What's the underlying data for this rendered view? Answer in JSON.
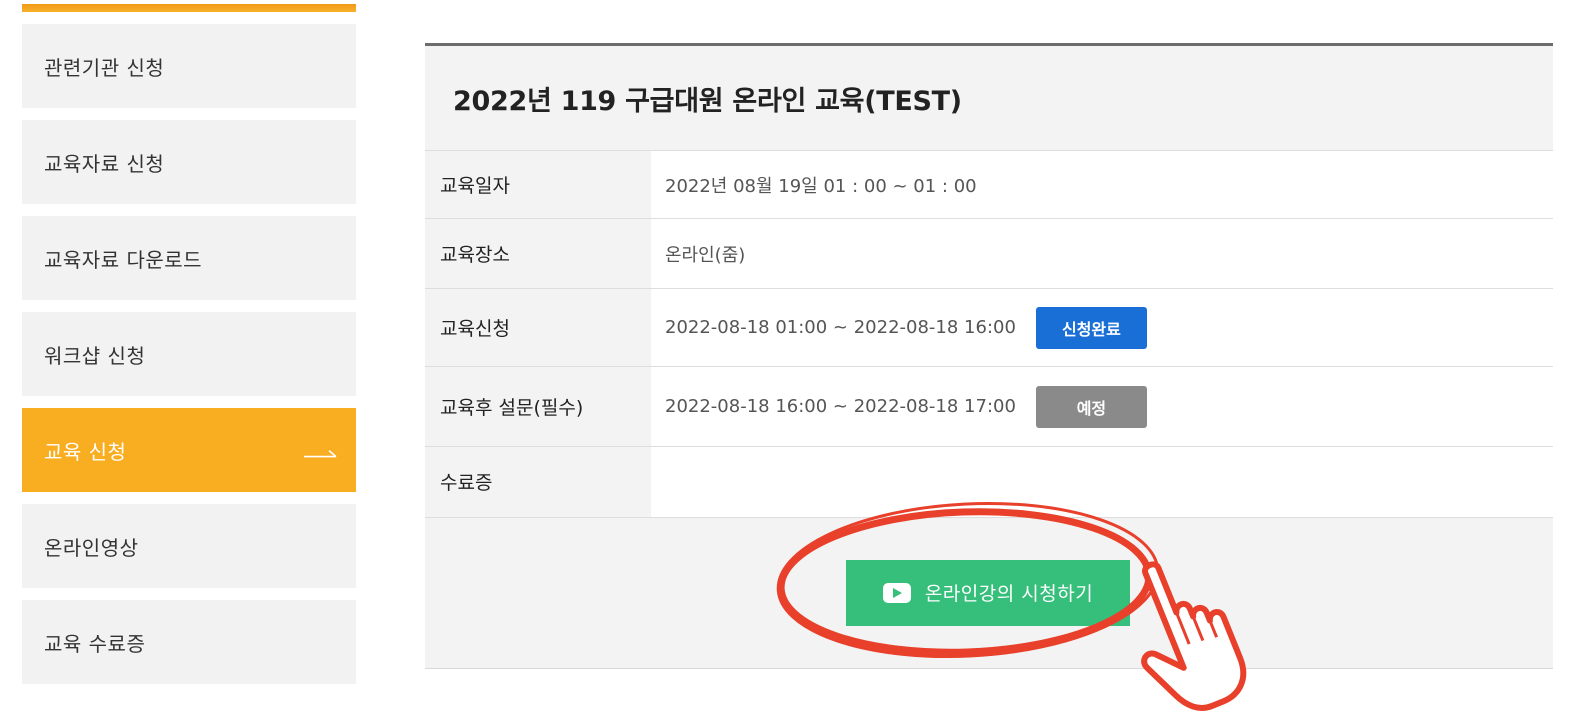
{
  "sidebar": {
    "items": [
      {
        "label": "관련기관 신청"
      },
      {
        "label": "교육자료 신청"
      },
      {
        "label": "교육자료 다운로드"
      },
      {
        "label": "워크샵 신청"
      },
      {
        "label": "교육 신청"
      },
      {
        "label": "온라인영상"
      },
      {
        "label": "교육 수료증"
      }
    ],
    "active_index": 4,
    "accent_color": "#f9ad20"
  },
  "course": {
    "title": "2022년 119 구급대원 온라인 교육(TEST)",
    "rows": [
      {
        "label": "교육일자",
        "value": "2022년 08월 19일  01 : 00 ~ 01 : 00"
      },
      {
        "label": "교육장소",
        "value": "온라인(줌)"
      },
      {
        "label": "교육신청",
        "value": "2022-08-18 01:00 ~ 2022-08-18 16:00",
        "badge": "신청완료",
        "badge_color": "#1a6fd6"
      },
      {
        "label": "교육후 설문(필수)",
        "value": "2022-08-18 16:00 ~ 2022-08-18 17:00",
        "badge": "예정",
        "badge_color": "#8a8a8a"
      },
      {
        "label": "수료증",
        "value": ""
      }
    ],
    "watch_button": {
      "label": "온라인강의 시청하기",
      "icon": "play-icon",
      "color": "#35bf7a"
    }
  },
  "annotation": {
    "circle_color": "#e8402a",
    "pointer_icon": "hand-pointer-icon"
  }
}
